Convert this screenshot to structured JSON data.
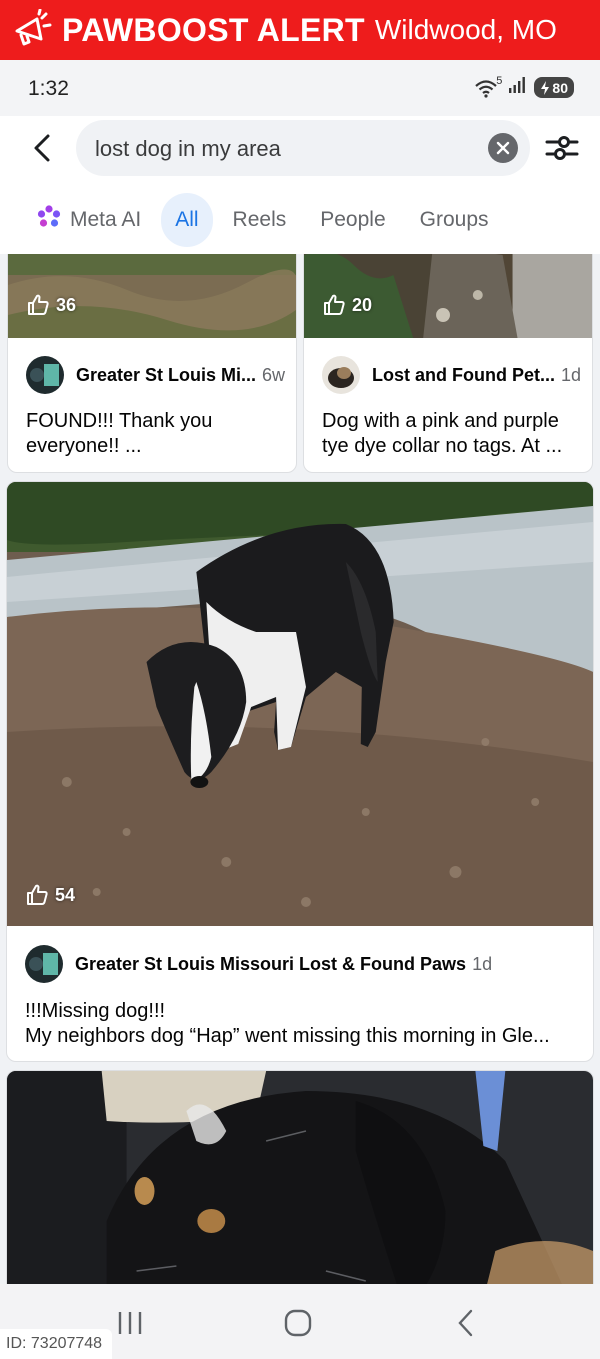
{
  "banner": {
    "brand": "PAWBOOST ALERT",
    "location": "Wildwood, MO",
    "icon": "megaphone-icon",
    "color": "#ee1c1c"
  },
  "status_bar": {
    "time": "1:32",
    "wifi_label": "5",
    "battery": "80"
  },
  "search": {
    "query": "lost dog in my area",
    "back_icon": "back-arrow-icon",
    "clear_icon": "clear-icon",
    "filter_icon": "filter-icon"
  },
  "tabs": [
    {
      "label": "Meta AI",
      "icon": "meta-ai-icon"
    },
    {
      "label": "All",
      "active": true
    },
    {
      "label": "Reels"
    },
    {
      "label": "People"
    },
    {
      "label": "Groups"
    }
  ],
  "accent_color": "#1b74e4",
  "posts": [
    {
      "likes": "36",
      "author": "Greater St Louis Mi...",
      "age": "6w",
      "text": "FOUND!!! Thank you everyone!! ..."
    },
    {
      "likes": "20",
      "author": "Lost and Found Pet...",
      "age": "1d",
      "text": "Dog with a pink and purple tye dye collar no tags. At ..."
    },
    {
      "likes": "54",
      "author": "Greater St Louis Missouri Lost & Found Paws",
      "age": "1d",
      "text_line1": "!!!Missing dog!!!",
      "text_line2": "My neighbors dog “Hap” went missing this morning in Gle..."
    }
  ],
  "watermark": "ID: 73207748"
}
